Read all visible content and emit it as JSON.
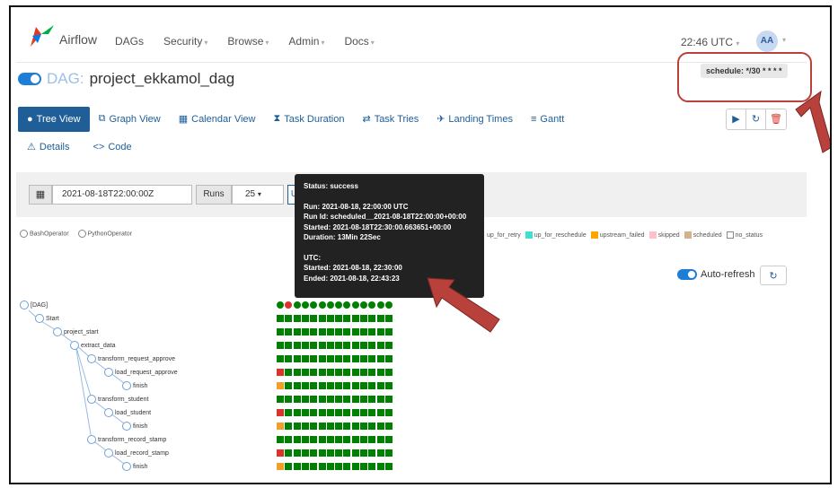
{
  "navbar": {
    "brand": "Airflow",
    "items": [
      "DAGs",
      "Security",
      "Browse",
      "Admin",
      "Docs"
    ],
    "time": "22:46 UTC",
    "avatar": "AA"
  },
  "dag": {
    "prefix": "DAG:",
    "name": "project_ekkamol_dag",
    "schedule": "schedule: */30 * * * *"
  },
  "tabs": {
    "row1": [
      {
        "label": "Tree View",
        "icon": "tree-icon"
      },
      {
        "label": "Graph View",
        "icon": "graph-icon"
      },
      {
        "label": "Calendar View",
        "icon": "calendar-icon"
      },
      {
        "label": "Task Duration",
        "icon": "hourglass-icon"
      },
      {
        "label": "Task Tries",
        "icon": "retry-icon"
      },
      {
        "label": "Landing Times",
        "icon": "landing-icon"
      },
      {
        "label": "Gantt",
        "icon": "gantt-icon"
      }
    ],
    "row2": [
      {
        "label": "Details",
        "icon": "warning-icon"
      },
      {
        "label": "Code",
        "icon": "code-icon"
      }
    ]
  },
  "filter": {
    "date_value": "2021-08-18T22:00:00Z",
    "runs_label": "Runs",
    "runs_value": "25",
    "update_label": "Update"
  },
  "legend": {
    "operators": [
      "BashOperator",
      "PythonOperator"
    ],
    "states": [
      {
        "label": "up_for_retry",
        "color": "#f0e442"
      },
      {
        "label": "up_for_reschedule",
        "color": "#40e0d0"
      },
      {
        "label": "upstream_failed",
        "color": "#ffa500"
      },
      {
        "label": "skipped",
        "color": "#ffc0cb"
      },
      {
        "label": "scheduled",
        "color": "#d2b48c"
      },
      {
        "label": "no_status",
        "color": "#ffffff"
      }
    ]
  },
  "autorefresh": {
    "label": "Auto-refresh"
  },
  "tree": [
    {
      "label": "[DAG]"
    },
    {
      "label": "Start"
    },
    {
      "label": "project_start"
    },
    {
      "label": "extract_data"
    },
    {
      "label": "transform_request_approve"
    },
    {
      "label": "load_request_approve"
    },
    {
      "label": "finish"
    },
    {
      "label": "transform_student"
    },
    {
      "label": "load_student"
    },
    {
      "label": "finish"
    },
    {
      "label": "transform_record_stamp"
    },
    {
      "label": "load_record_stamp"
    },
    {
      "label": "finish"
    }
  ],
  "tooltip": {
    "status": "Status: success",
    "run": "Run: 2021-08-18, 22:00:00 UTC",
    "run_id": "Run Id: scheduled__2021-08-18T22:00:00+00:00",
    "started": "Started: 2021-08-18T22:30:00.663651+00:00",
    "duration": "Duration: 13Min 22Sec",
    "utc": "UTC:",
    "utc_started": "Started: 2021-08-18, 22:30:00",
    "utc_ended": "Ended: 2021-08-18, 22:43:23"
  },
  "colors": {
    "success": "#008000",
    "failed": "#d9342b",
    "upstream_failed": "#f0a02a",
    "annotation": "#b9413c"
  }
}
